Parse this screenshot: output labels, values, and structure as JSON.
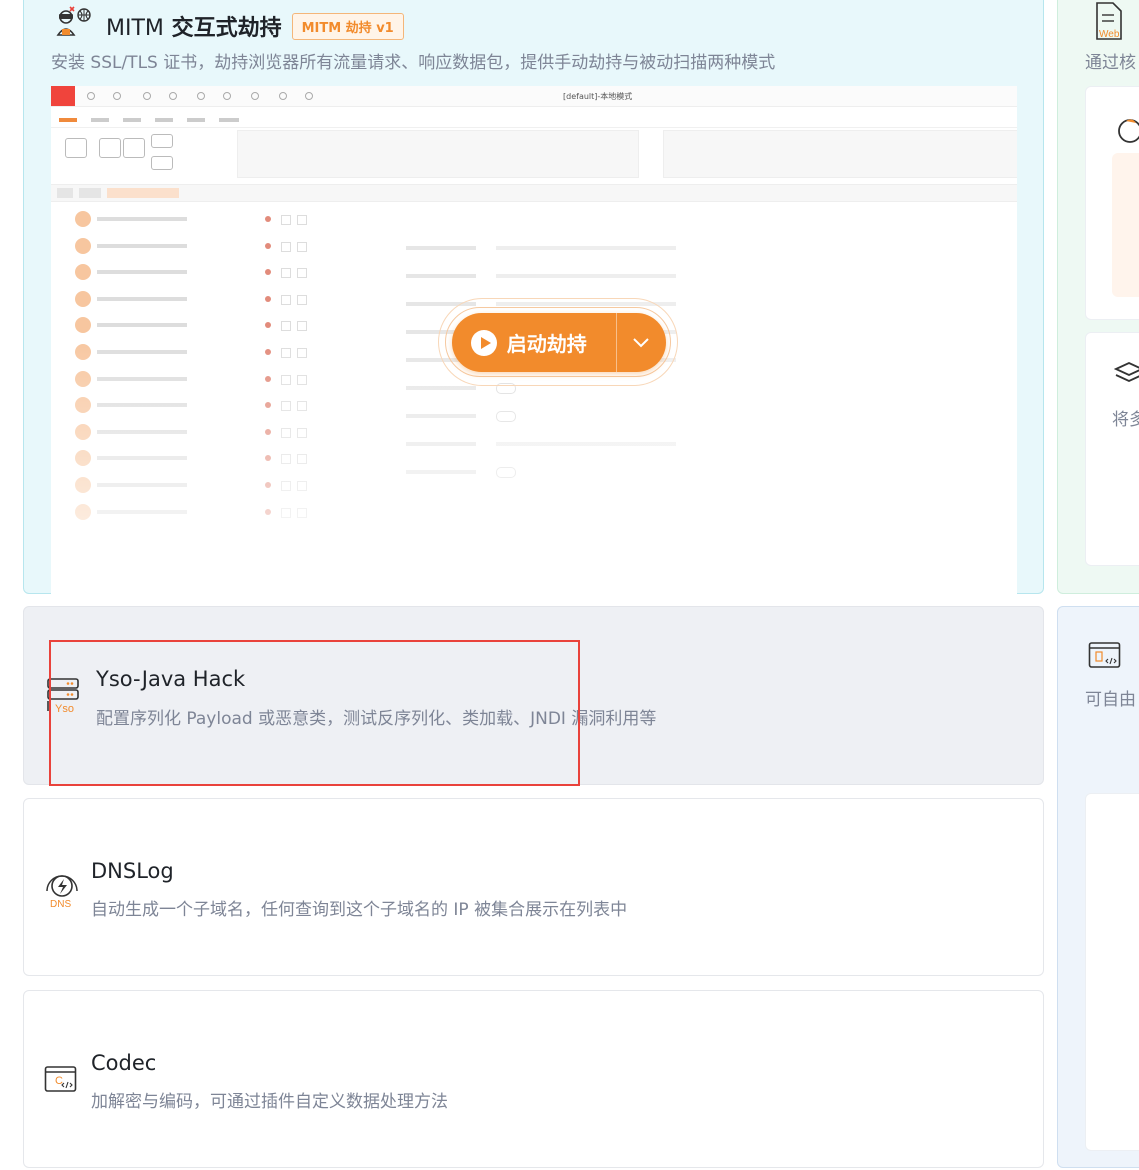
{
  "mitm": {
    "title_cn": "交互式劫持",
    "title_prefix": "MITM",
    "badge": "MITM 劫持 v1",
    "description": "安装 SSL/TLS 证书，劫持浏览器所有流量请求、响应数据包，提供手动劫持与被动扫描两种模式",
    "preview_mode_label": "[default]-本地模式",
    "start_button_label": "启动劫持",
    "icon": "hacker-globe-icon"
  },
  "tools": [
    {
      "title": "Yso-Java Hack",
      "description": "配置序列化 Payload 或恶意类，测试反序列化、类加载、JNDI 漏洞利用等",
      "icon": "yso-server-icon",
      "icon_label": "Yso"
    },
    {
      "title": "DNSLog",
      "description": "自动生成一个子域名，任何查询到这个子域名的 IP 被集合展示在列表中",
      "icon": "dnslog-bolt-icon",
      "icon_label": "DNS"
    },
    {
      "title": "Codec",
      "description": "加解密与编码，可通过插件自定义数据处理方法",
      "icon": "codec-window-icon",
      "icon_label": "C"
    }
  ],
  "right_column": {
    "top_desc": "通过核",
    "top_icon": "web-document-icon",
    "top_icon_label": "Web",
    "layer_desc": "将多",
    "bottom_desc": "可自由",
    "bottom_icon": "codec-window-icon"
  },
  "colors": {
    "accent": "#f28b2c",
    "highlight": "#e9423b",
    "mitm_bg": "#e8f8fb"
  }
}
